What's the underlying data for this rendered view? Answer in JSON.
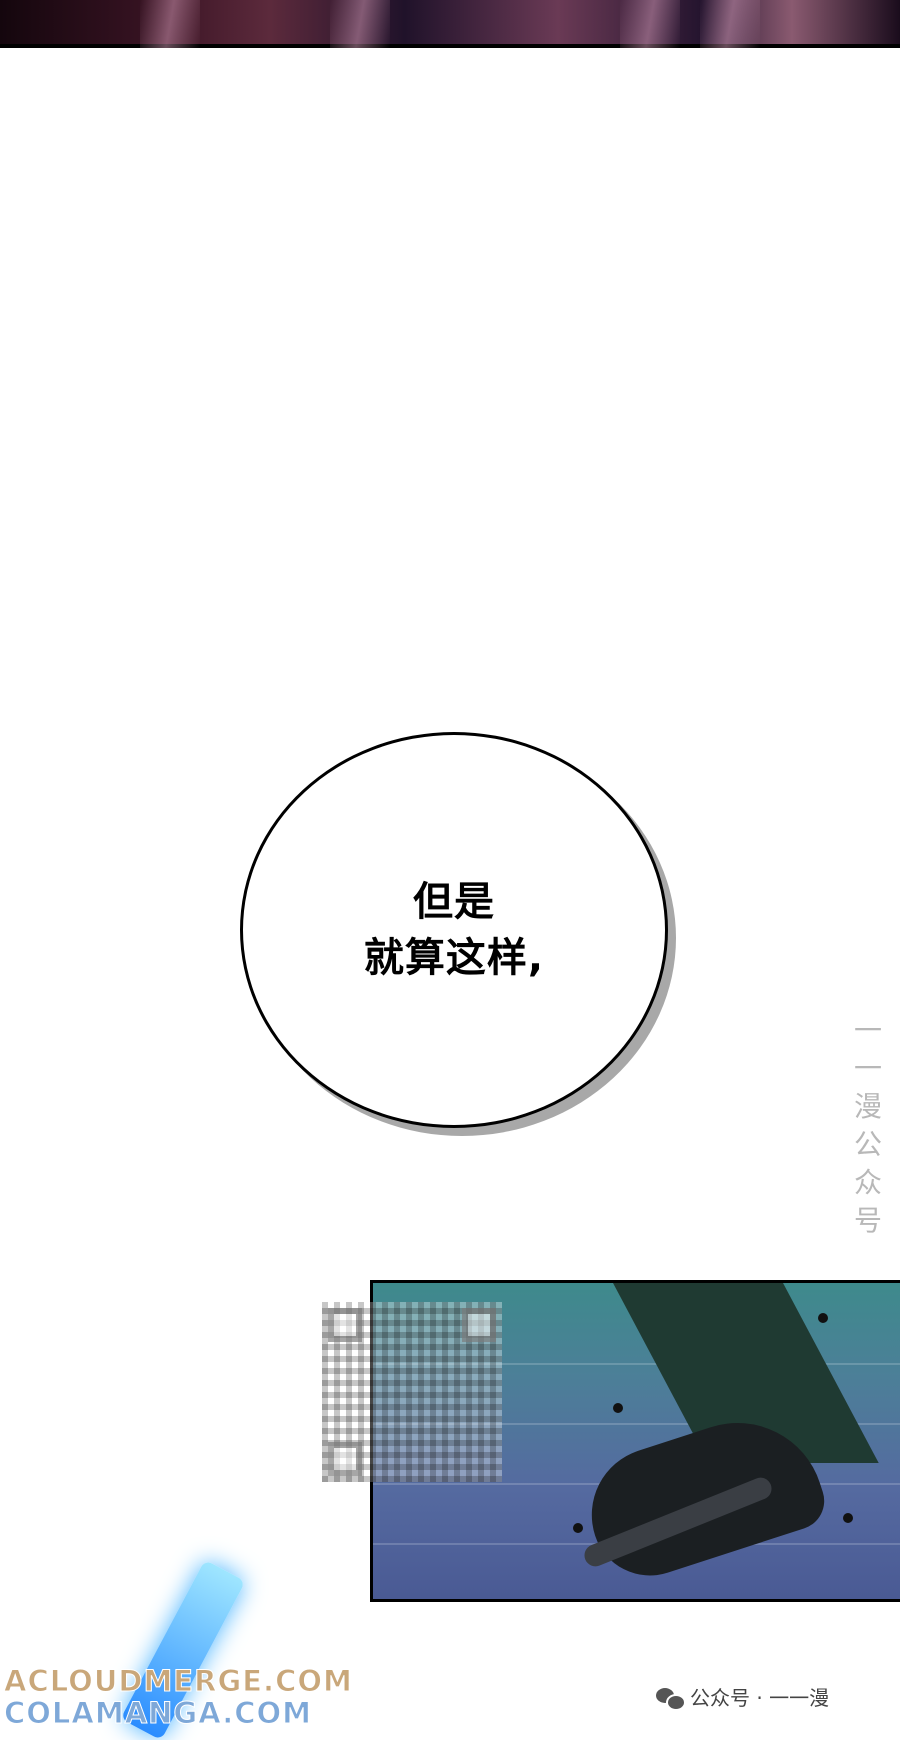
{
  "speech_bubble": {
    "line1": "但是",
    "line2": "就算这样,"
  },
  "vertical_watermark": [
    "一",
    "一",
    "漫",
    "公",
    "众",
    "号"
  ],
  "site_watermarks": [
    "ACLOUDMERGE.COM",
    "COLAMANGA.COM"
  ],
  "wechat_footer": {
    "icon": "wechat-icon",
    "text": "公众号 · 一一漫"
  },
  "colors": {
    "bubble_border": "#000000",
    "bubble_shadow": "#a8a8a8",
    "panel_water": "#4c7f98"
  }
}
